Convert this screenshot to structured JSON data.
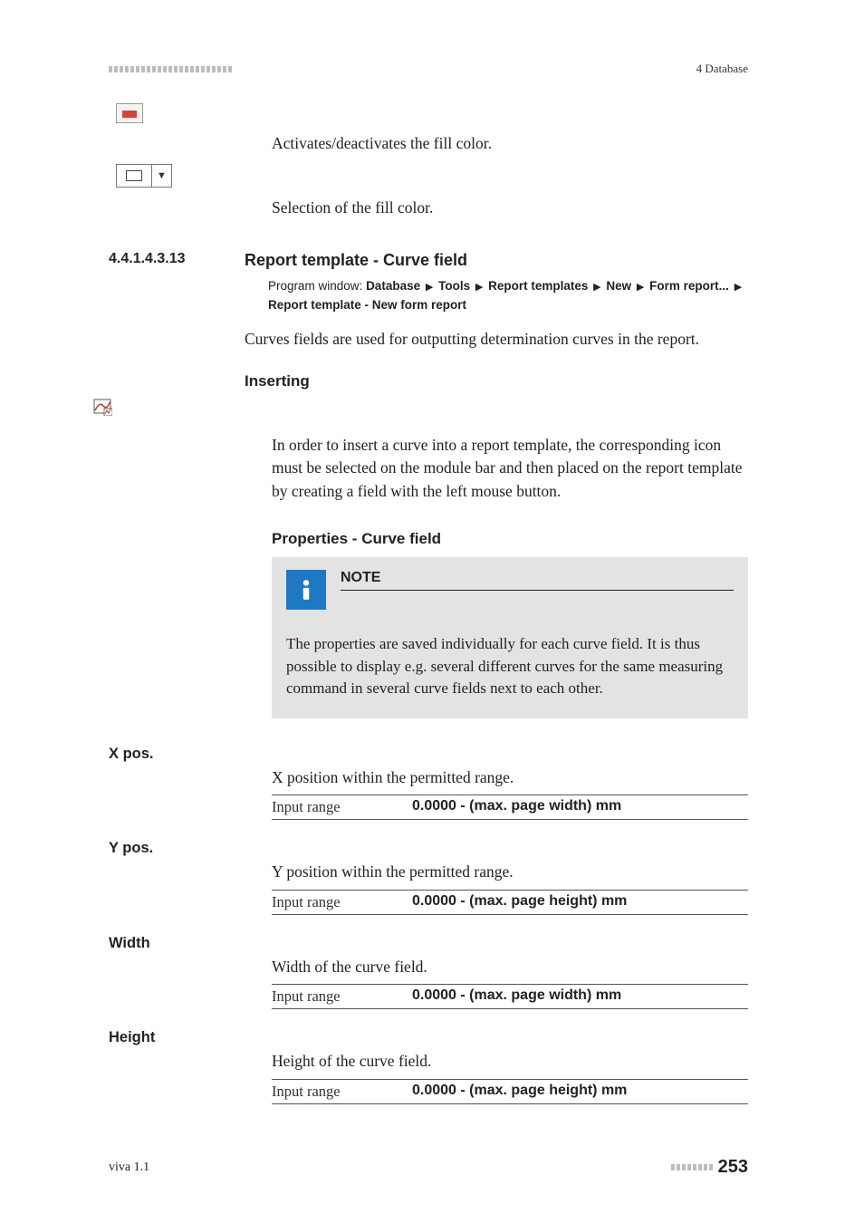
{
  "header": {
    "rightLabel": "4 Database"
  },
  "fillColor": {
    "activateText": "Activates/deactivates the fill color.",
    "selectText": "Selection of the fill color."
  },
  "section": {
    "number": "4.4.1.4.3.13",
    "title": "Report template - Curve field",
    "breadcrumbLabel": "Program window:",
    "bc1": "Database",
    "bc2": "Tools",
    "bc3": "Report templates",
    "bc4": "New",
    "bc5": "Form report...",
    "bc6": "Report template - New form report",
    "intro": "Curves fields are used for outputting determination curves in the report.",
    "insertingHeading": "Inserting",
    "insertingBody": "In order to insert a curve into a report template, the corresponding icon must be selected on the module bar and then placed on the report template by creating a field with the left mouse button.",
    "propsHeading": "Properties - Curve field"
  },
  "note": {
    "title": "NOTE",
    "body": "The properties are saved individually for each curve field. It is thus possible to display e.g. several different curves for the same measuring command in several curve fields next to each other."
  },
  "props": {
    "xpos": {
      "label": "X pos.",
      "desc": "X position within the permitted range.",
      "rangeLabel": "Input range",
      "rangeValue": "0.0000 - (max. page width) mm"
    },
    "ypos": {
      "label": "Y pos.",
      "desc": "Y position within the permitted range.",
      "rangeLabel": "Input range",
      "rangeValue": "0.0000 - (max. page height) mm"
    },
    "width": {
      "label": "Width",
      "desc": "Width of the curve field.",
      "rangeLabel": "Input range",
      "rangeValue": "0.0000 - (max. page width) mm"
    },
    "height": {
      "label": "Height",
      "desc": "Height of the curve field.",
      "rangeLabel": "Input range",
      "rangeValue": "0.0000 - (max. page height) mm"
    }
  },
  "footer": {
    "left": "viva 1.1",
    "page": "253"
  }
}
